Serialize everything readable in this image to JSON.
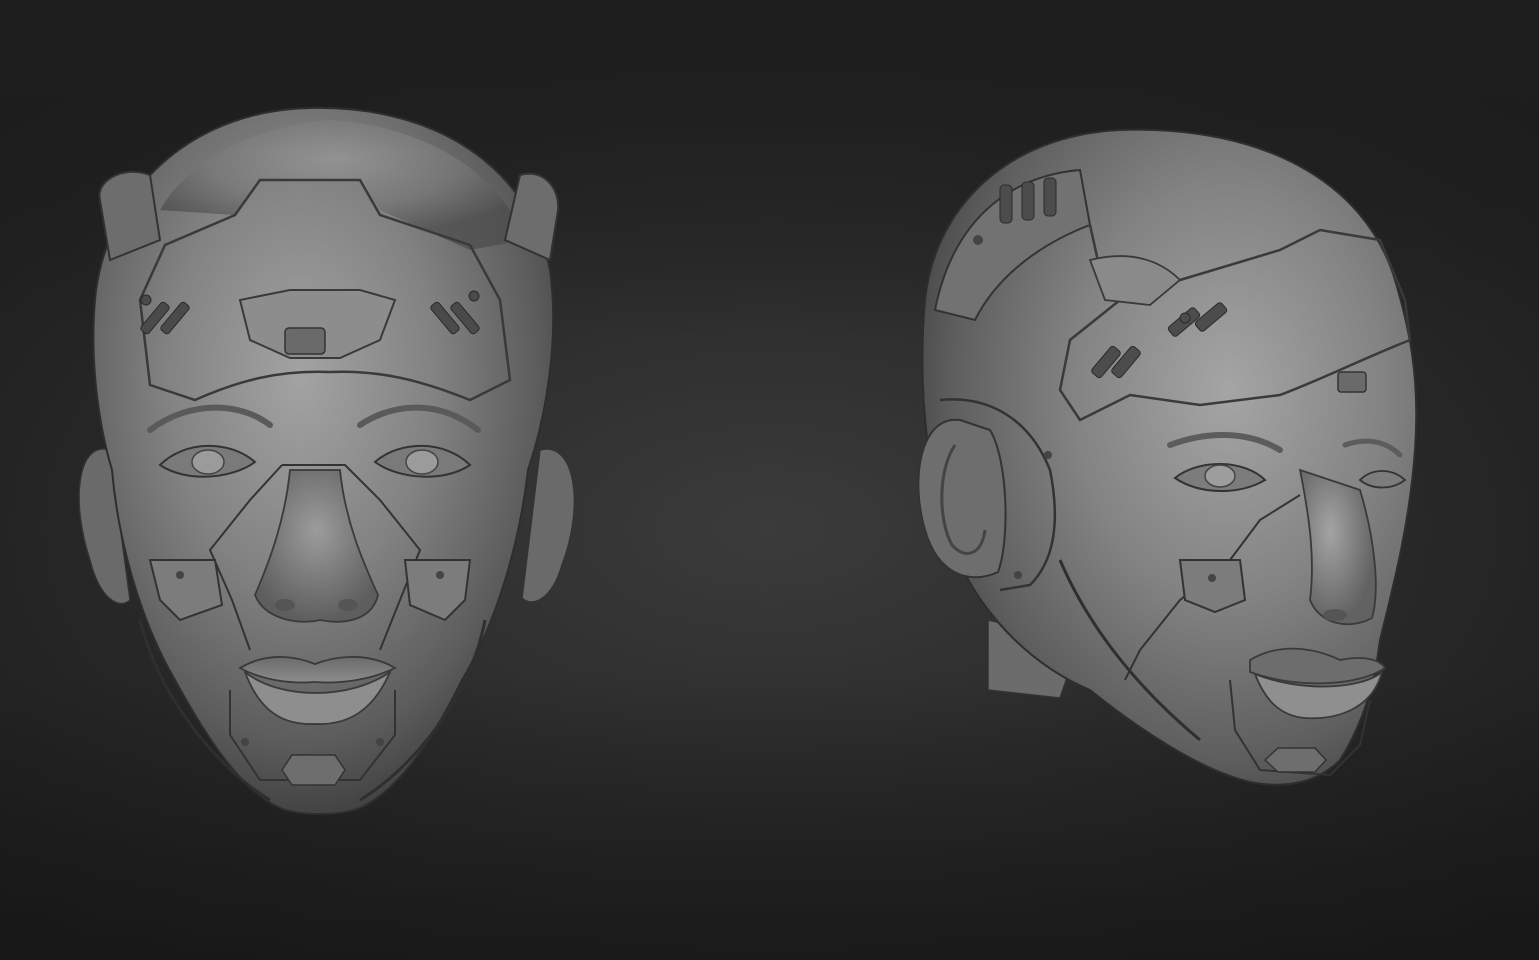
{
  "scene": {
    "background_color": "#2a2a2a",
    "material_color": "#8a8a8a",
    "views": [
      {
        "id": "front",
        "kind": "sculpt-render",
        "subject": "cyborg-head",
        "angle": "front"
      },
      {
        "id": "three-quarter",
        "kind": "sculpt-render",
        "subject": "cyborg-head",
        "angle": "three-quarter-right"
      }
    ]
  }
}
